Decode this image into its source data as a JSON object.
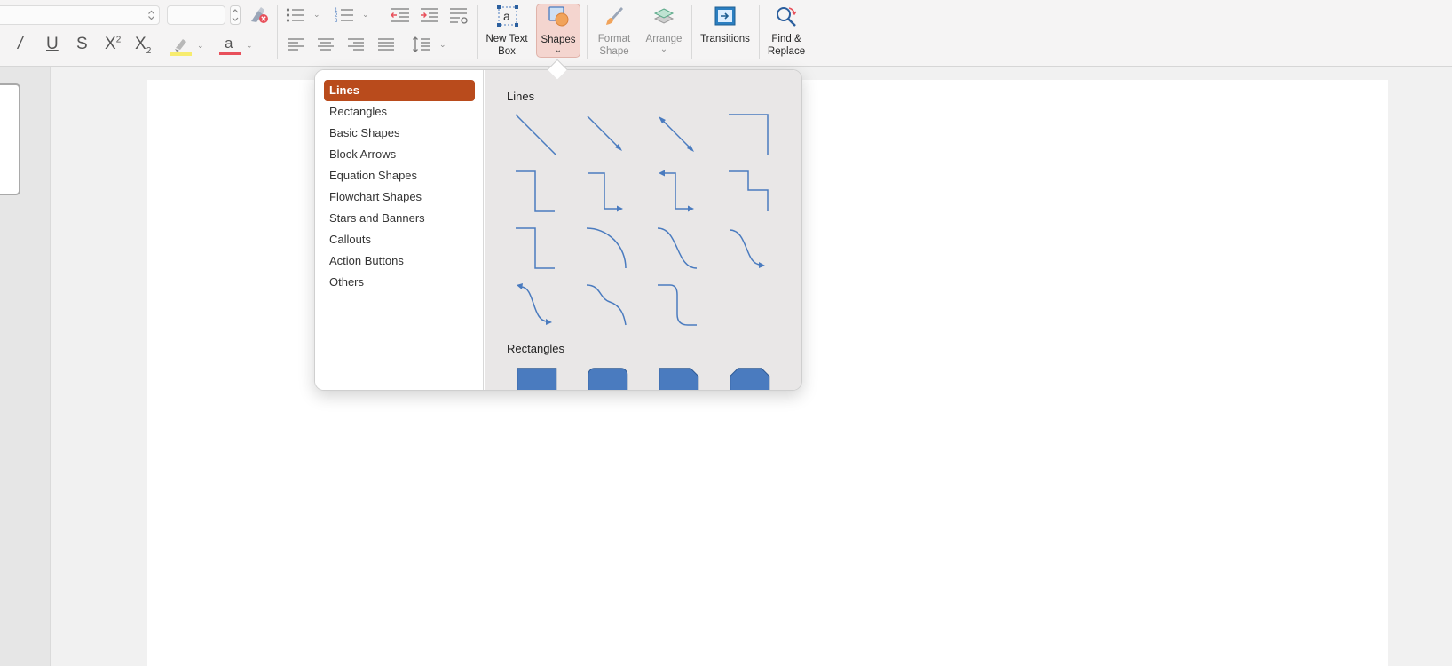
{
  "app": {
    "accent": "#b94b1c",
    "shape_stroke": "#4a7bbf",
    "shape_fill": "#4a7bbf"
  },
  "toolbar": {
    "font_controls": {
      "italic_glyph": "/",
      "underline_glyph": "U",
      "strike_glyph": "S",
      "superscript_glyph": "X",
      "superscript_mark": "2",
      "subscript_glyph": "X",
      "subscript_mark": "2",
      "font_color_glyph": "a",
      "highlight_color": "#f7ec6e",
      "font_color": "#e8505b"
    },
    "icons": [
      "stepper-icon",
      "clear-formatting-icon",
      "bullets-icon",
      "numbering-icon",
      "decrease-indent-icon",
      "increase-indent-icon",
      "paragraph-options-icon",
      "align-left-icon",
      "align-center-icon",
      "align-right-icon",
      "justify-icon",
      "line-spacing-icon",
      "highlight-icon",
      "font-color-icon"
    ],
    "buttons": {
      "new_text_box": {
        "line1": "New Text",
        "line2": "Box"
      },
      "shapes": {
        "label": "Shapes"
      },
      "format_shape": {
        "line1": "Format",
        "line2": "Shape"
      },
      "arrange": {
        "label": "Arrange"
      },
      "transitions": {
        "label": "Transitions"
      },
      "find_replace": {
        "line1": "Find &",
        "line2": "Replace"
      }
    }
  },
  "shapes_popover": {
    "categories": [
      {
        "label": "Lines",
        "selected": true
      },
      {
        "label": "Rectangles"
      },
      {
        "label": "Basic Shapes"
      },
      {
        "label": "Block Arrows"
      },
      {
        "label": "Equation Shapes"
      },
      {
        "label": "Flowchart Shapes"
      },
      {
        "label": "Stars and Banners"
      },
      {
        "label": "Callouts"
      },
      {
        "label": "Action Buttons"
      },
      {
        "label": "Others"
      }
    ],
    "sections": {
      "lines": {
        "title": "Lines",
        "items": [
          "line",
          "line-arrow",
          "line-double-arrow",
          "elbow-connector",
          "elbow-connector-alt",
          "elbow-connector-arrow",
          "elbow-connector-double-arrow",
          "elbow-connector-step",
          "elbow-connector-plain",
          "arc",
          "curved-connector",
          "curved-connector-arrow",
          "curved-connector-double-arrow",
          "s-curve",
          "curved-step"
        ]
      },
      "rectangles": {
        "title": "Rectangles",
        "items": [
          "rectangle",
          "rounded-rectangle",
          "snip-corner-rectangle",
          "snip-two-corner-rectangle"
        ]
      }
    }
  }
}
